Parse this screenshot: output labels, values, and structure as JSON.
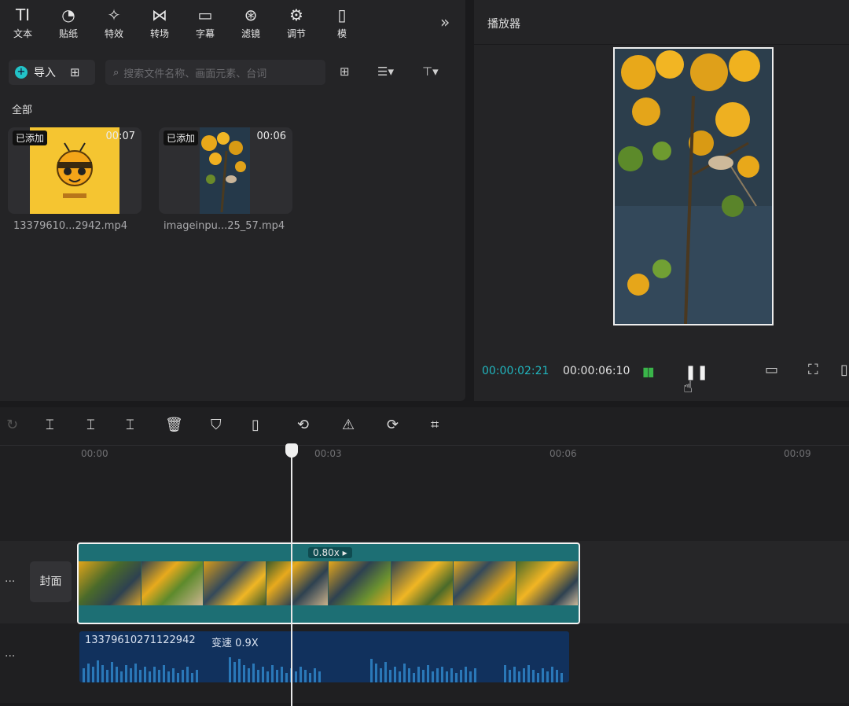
{
  "toolbar": {
    "items": [
      {
        "label": "文本",
        "icon": "TI"
      },
      {
        "label": "贴纸",
        "icon": "◔"
      },
      {
        "label": "特效",
        "icon": "✧"
      },
      {
        "label": "转场",
        "icon": "⋈"
      },
      {
        "label": "字幕",
        "icon": "▭"
      },
      {
        "label": "滤镜",
        "icon": "⊛"
      },
      {
        "label": "调节",
        "icon": "⚙"
      },
      {
        "label": "模",
        "icon": "▯"
      }
    ],
    "more": "»"
  },
  "media": {
    "import_label": "导入",
    "search_placeholder": "搜索文件名称、画面元素、台词",
    "section": "全部",
    "items": [
      {
        "badge": "已添加",
        "duration": "00:07",
        "name": "13379610...2942.mp4"
      },
      {
        "badge": "已添加",
        "duration": "00:06",
        "name": "imageinpu...25_57.mp4"
      }
    ]
  },
  "player": {
    "title": "播放器",
    "current_time": "00:00:02:21",
    "total_time": "00:00:06:10"
  },
  "timeline": {
    "ticks": [
      "00:00",
      "00:03",
      "00:06",
      "00:09"
    ],
    "cover_label": "封面",
    "video_speed": "0.80x ▸",
    "audio_name": "13379610271122942",
    "audio_speed": "变速 0.9X"
  },
  "colors": {
    "accent": "#22c3c8",
    "video_clip": "#1d6f74",
    "audio_clip": "#11315d"
  }
}
